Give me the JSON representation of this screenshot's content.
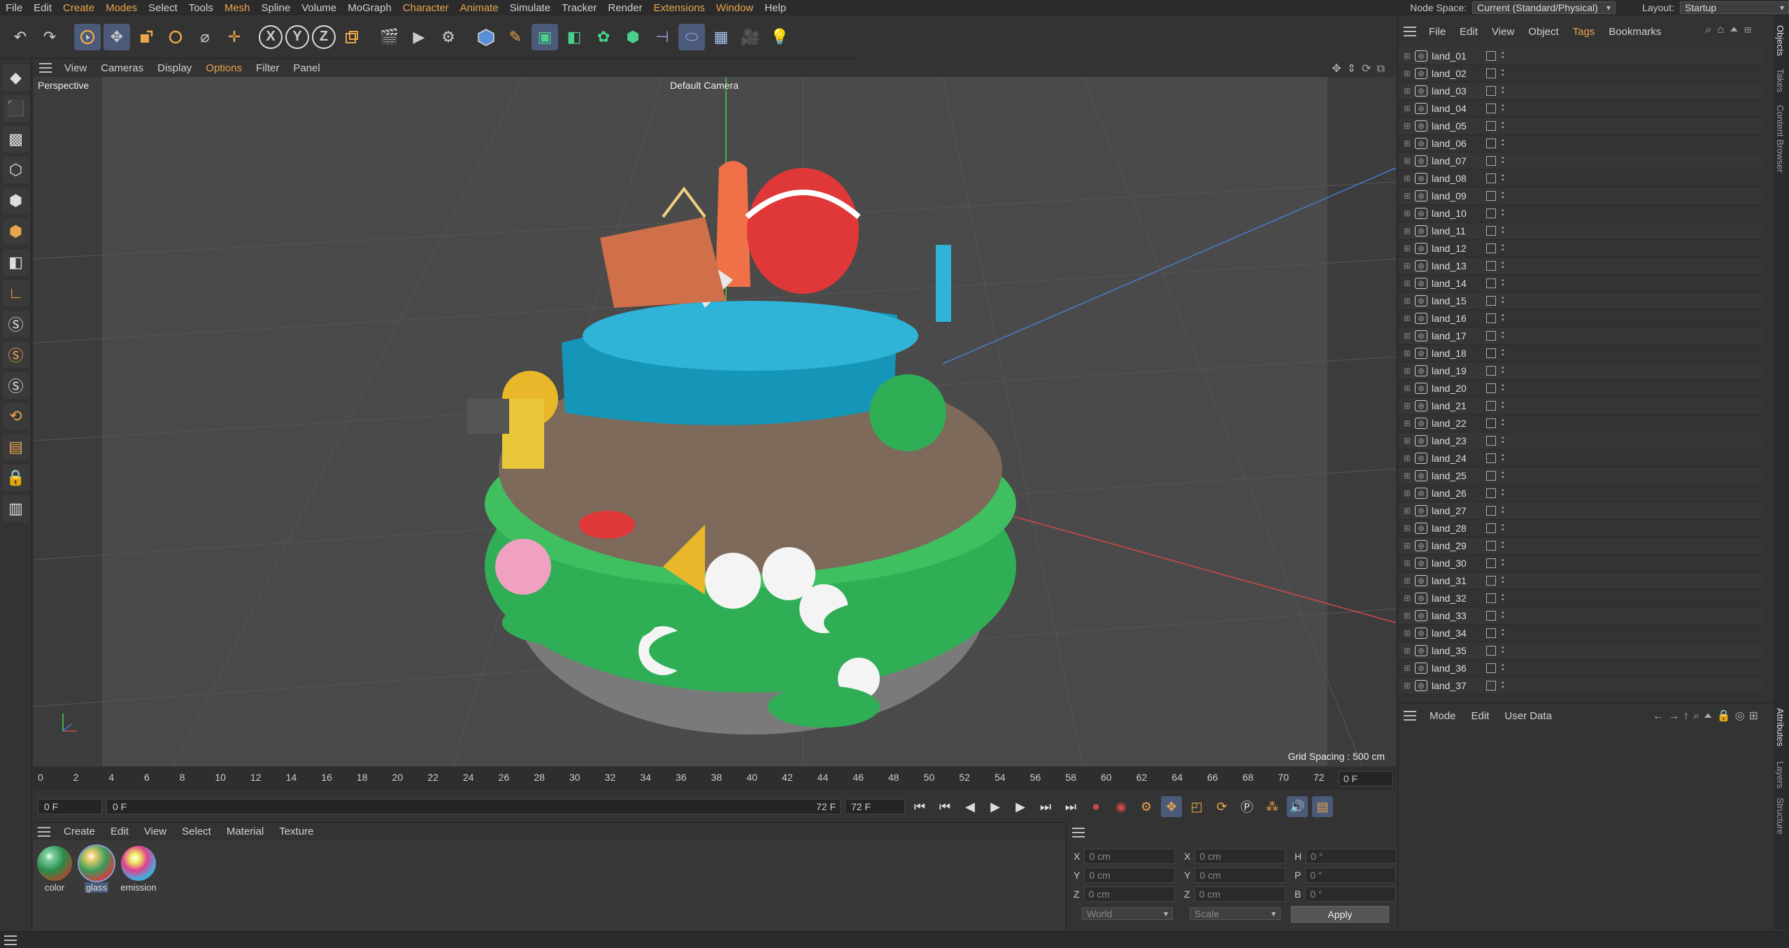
{
  "menubar": {
    "items": [
      "File",
      "Edit",
      "Create",
      "Modes",
      "Select",
      "Tools",
      "Mesh",
      "Spline",
      "Volume",
      "MoGraph",
      "Character",
      "Animate",
      "Simulate",
      "Tracker",
      "Render",
      "Extensions",
      "Window",
      "Help"
    ],
    "node_space_label": "Node Space:",
    "node_space_value": "Current (Standard/Physical)",
    "layout_label": "Layout:",
    "layout_value": "Startup"
  },
  "viewport": {
    "menu": [
      "View",
      "Cameras",
      "Display",
      "Options",
      "Filter",
      "Panel"
    ],
    "label": "Perspective",
    "camera": "Default Camera",
    "grid_spacing": "Grid Spacing : 500 cm"
  },
  "timeline": {
    "ticks": [
      "0",
      "2",
      "4",
      "6",
      "8",
      "10",
      "12",
      "14",
      "16",
      "18",
      "20",
      "22",
      "24",
      "26",
      "28",
      "30",
      "32",
      "34",
      "36",
      "38",
      "40",
      "42",
      "44",
      "46",
      "48",
      "50",
      "52",
      "54",
      "56",
      "58",
      "60",
      "62",
      "64",
      "66",
      "68",
      "70",
      "72"
    ],
    "current_frame": "0 F"
  },
  "playbar": {
    "start": "0 F",
    "min": "0 F",
    "max": "72 F",
    "end": "72 F"
  },
  "materials": {
    "menu": [
      "Create",
      "Edit",
      "View",
      "Select",
      "Material",
      "Texture"
    ],
    "items": [
      {
        "name": "color"
      },
      {
        "name": "glass"
      },
      {
        "name": "emission"
      }
    ]
  },
  "coordinates": {
    "rows": [
      {
        "a": "X",
        "av": "0 cm",
        "b": "X",
        "bv": "0 cm",
        "c": "H",
        "cv": "0 °"
      },
      {
        "a": "Y",
        "av": "0 cm",
        "b": "Y",
        "bv": "0 cm",
        "c": "P",
        "cv": "0 °"
      },
      {
        "a": "Z",
        "av": "0 cm",
        "b": "Z",
        "bv": "0 cm",
        "c": "B",
        "cv": "0 °"
      }
    ],
    "space": "World",
    "mode": "Scale",
    "apply": "Apply"
  },
  "objects": {
    "menu": [
      "File",
      "Edit",
      "View",
      "Object",
      "Tags",
      "Bookmarks"
    ],
    "items": [
      "land_01",
      "land_02",
      "land_03",
      "land_04",
      "land_05",
      "land_06",
      "land_07",
      "land_08",
      "land_09",
      "land_10",
      "land_11",
      "land_12",
      "land_13",
      "land_14",
      "land_15",
      "land_16",
      "land_17",
      "land_18",
      "land_19",
      "land_20",
      "land_21",
      "land_22",
      "land_23",
      "land_24",
      "land_25",
      "land_26",
      "land_27",
      "land_28",
      "land_29",
      "land_30",
      "land_31",
      "land_32",
      "land_33",
      "land_34",
      "land_35",
      "land_36",
      "land_37"
    ]
  },
  "attributes": {
    "menu": [
      "Mode",
      "Edit",
      "User Data"
    ]
  },
  "side_tabs": [
    "Objects",
    "Takes",
    "Content Browser",
    "Attributes",
    "Layers",
    "Structure"
  ],
  "colors": {
    "accent": "#e8a54b",
    "active_tool": "#4a5a78",
    "axis_x": "#d04a4a",
    "axis_y": "#4ad04a",
    "axis_z": "#4a7ad0"
  }
}
